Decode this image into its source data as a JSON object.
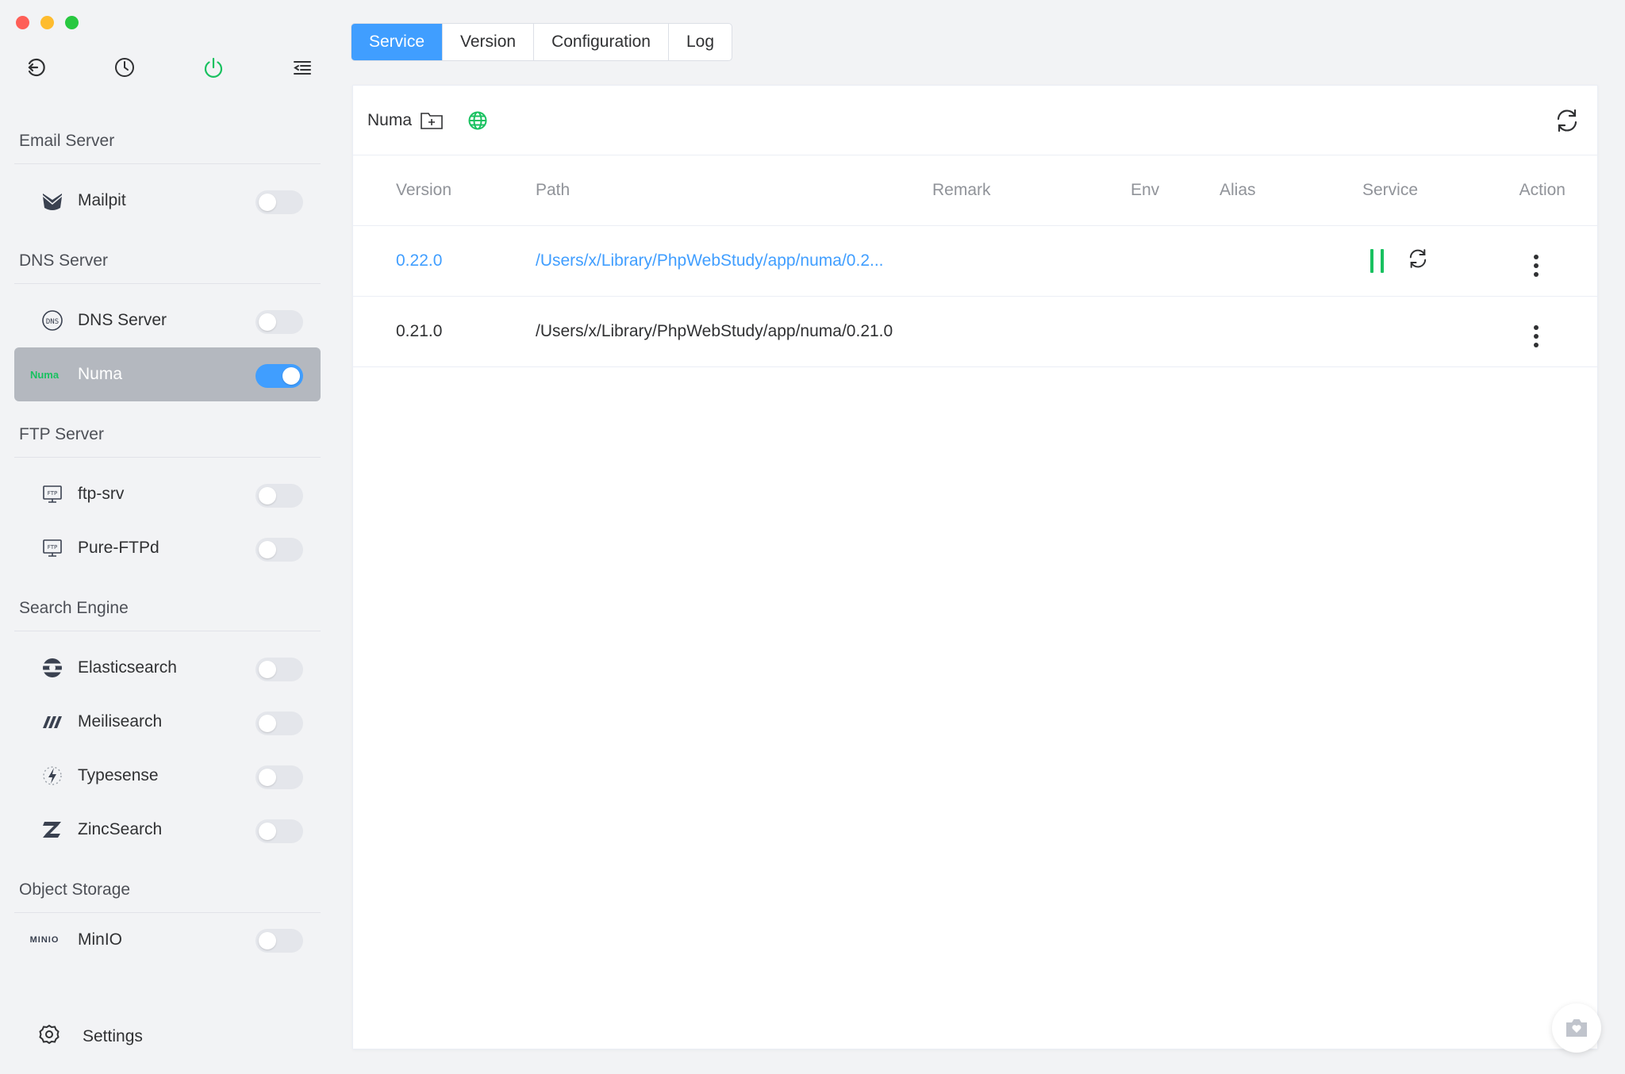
{
  "toolbar": {
    "icons": [
      "back-icon",
      "clock-icon",
      "power-icon",
      "menu-icon"
    ]
  },
  "sidebar": {
    "groups": [
      {
        "title": "Email Server",
        "items": [
          {
            "label": "Mailpit",
            "icon": "mailpit-icon",
            "enabled": false
          }
        ]
      },
      {
        "title": "DNS Server",
        "items": [
          {
            "label": "DNS Server",
            "icon": "dns-icon",
            "enabled": false
          },
          {
            "label": "Numa",
            "icon": "numa-logo",
            "enabled": true,
            "logo_text": "Numa"
          }
        ]
      },
      {
        "title": "FTP Server",
        "items": [
          {
            "label": "ftp-srv",
            "icon": "ftp-icon",
            "enabled": false
          },
          {
            "label": "Pure-FTPd",
            "icon": "ftp-icon",
            "enabled": false
          }
        ]
      },
      {
        "title": "Search Engine",
        "items": [
          {
            "label": "Elasticsearch",
            "icon": "elasticsearch-icon",
            "enabled": false
          },
          {
            "label": "Meilisearch",
            "icon": "meilisearch-icon",
            "enabled": false
          },
          {
            "label": "Typesense",
            "icon": "typesense-icon",
            "enabled": false
          },
          {
            "label": "ZincSearch",
            "icon": "zincsearch-icon",
            "enabled": false
          }
        ]
      },
      {
        "title": "Object Storage",
        "items": [
          {
            "label": "MinIO",
            "icon": "minio-logo",
            "enabled": false,
            "logo_text": "MINIO"
          }
        ]
      }
    ],
    "settings_label": "Settings"
  },
  "tabs": [
    {
      "label": "Service",
      "active": true
    },
    {
      "label": "Version",
      "active": false
    },
    {
      "label": "Configuration",
      "active": false
    },
    {
      "label": "Log",
      "active": false
    }
  ],
  "panel": {
    "title": "Numa",
    "columns": [
      "Version",
      "Path",
      "Remark",
      "Env",
      "Alias",
      "Service",
      "Action"
    ],
    "rows": [
      {
        "version": "0.22.0",
        "path": "/Users/x/Library/PhpWebStudy/app/numa/0.2...",
        "remark": "",
        "env": "",
        "alias": "",
        "running": true
      },
      {
        "version": "0.21.0",
        "path": "/Users/x/Library/PhpWebStudy/app/numa/0.21.0",
        "remark": "",
        "env": "",
        "alias": "",
        "running": false
      }
    ]
  },
  "colors": {
    "accent": "#409eff",
    "running": "#19c160",
    "numa_logo": "#19c160"
  }
}
